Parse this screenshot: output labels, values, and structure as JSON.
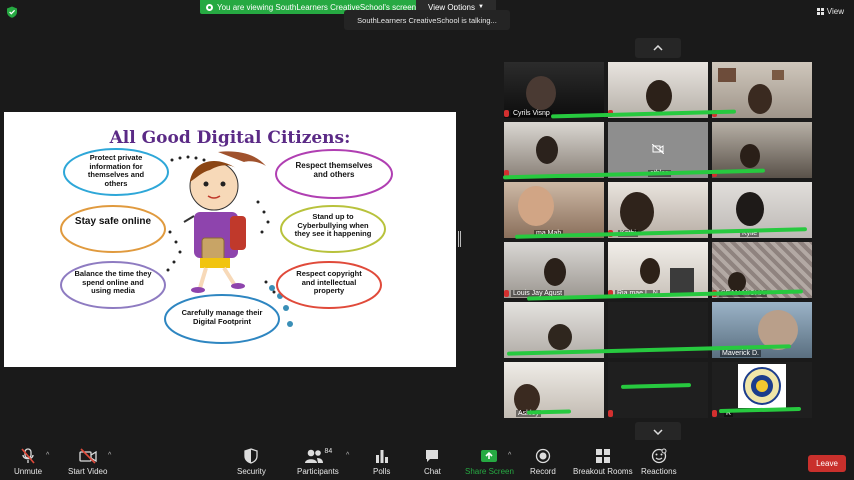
{
  "top_bar": {
    "banner_text": "You are viewing SouthLearners CreativeSchool's screen",
    "view_options_label": "View Options",
    "talking_text": "SouthLearners CreativeSchool is talking...",
    "view_label": "View"
  },
  "shared_slide": {
    "title": "All Good Digital Citizens:",
    "bubbles": [
      "Protect private information for themselves and others",
      "Respect themselves and others",
      "Stay safe online",
      "Stand up to Cyberbullying when they see it happening",
      "Balance the time they spend online and using media",
      "Respect copyright and intellectual property",
      "Carefully manage their Digital Footprint"
    ]
  },
  "gallery": {
    "tiles": [
      {
        "name": "Cyrils Visnp"
      },
      {
        "name": ""
      },
      {
        "name": ""
      },
      {
        "name": ""
      },
      {
        "name": "athles"
      },
      {
        "name": ""
      },
      {
        "name": "ma Mab"
      },
      {
        "name": "Kathi"
      },
      {
        "name": "Kylie"
      },
      {
        "name": "Louis Jay Agust"
      },
      {
        "name": "Ria mae L. N"
      },
      {
        "name": "SEAN MICHA"
      },
      {
        "name": ""
      },
      {
        "name": ""
      },
      {
        "name": "Maverick D."
      },
      {
        "name": "Ashley"
      },
      {
        "name": ""
      },
      {
        "name": "R"
      }
    ]
  },
  "toolbar": {
    "unmute": "Unmute",
    "start_video": "Start Video",
    "security": "Security",
    "participants": "Participants",
    "participants_count": "84",
    "polls": "Polls",
    "chat": "Chat",
    "share_screen": "Share Screen",
    "record": "Record",
    "breakout_rooms": "Breakout Rooms",
    "reactions": "Reactions",
    "leave": "Leave"
  },
  "colors": {
    "accent_green": "#26a942",
    "leave_red": "#c9302c",
    "title_purple": "#5b2a86"
  }
}
